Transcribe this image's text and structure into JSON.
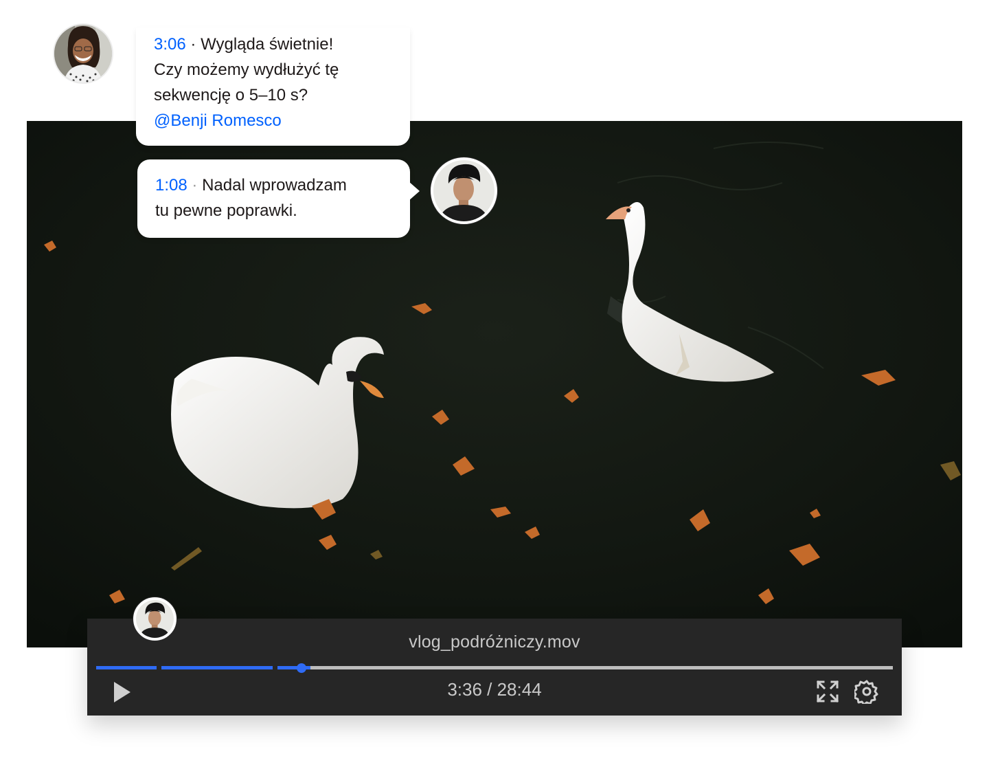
{
  "comments": [
    {
      "timestamp": "3:06",
      "separator": "·",
      "line1": "Wygląda świetnie!",
      "line2": "Czy możemy wydłużyć tę",
      "line3": "sekwencję o 5–10 s?",
      "mention": "@Benji Romesco"
    },
    {
      "timestamp": "1:08",
      "separator": "·",
      "line1": "Nadal wprowadzam",
      "line2": "tu pewne poprawki."
    }
  ],
  "player": {
    "file_name": "vlog_podróżniczy.mov",
    "current_time": "3:36",
    "time_separator": " / ",
    "duration": "28:44",
    "progress_fraction": 0.125
  },
  "colors": {
    "accent": "#0061fe",
    "seek_played": "#2f6bf5",
    "seek_remaining": "#bdbdbd",
    "player_bg": "#262626"
  },
  "icons": {
    "play": "play-icon",
    "fullscreen": "fullscreen-icon",
    "settings": "gear-icon"
  }
}
